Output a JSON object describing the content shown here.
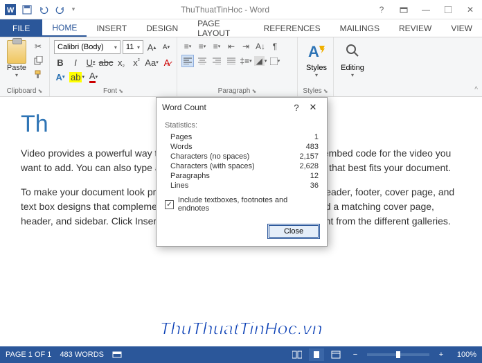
{
  "titlebar": {
    "title": "ThuThuatTinHoc - Word"
  },
  "tabs": {
    "file": "FILE",
    "home": "HOME",
    "insert": "INSERT",
    "design": "DESIGN",
    "page_layout": "PAGE LAYOUT",
    "references": "REFERENCES",
    "mailings": "MAILINGS",
    "review": "REVIEW",
    "view": "VIEW"
  },
  "ribbon": {
    "clipboard": {
      "paste": "Paste",
      "label": "Clipboard"
    },
    "font": {
      "name": "Calibri (Body)",
      "size": "11",
      "label": "Font"
    },
    "paragraph": {
      "label": "Paragraph"
    },
    "styles": {
      "button": "Styles",
      "label": "Styles"
    },
    "editing": {
      "button": "Editing"
    }
  },
  "dialog": {
    "title": "Word Count",
    "help": "?",
    "stats_label": "Statistics:",
    "rows": {
      "pages": {
        "label": "Pages",
        "value": "1"
      },
      "words": {
        "label": "Words",
        "value": "483"
      },
      "chars_ns": {
        "label": "Characters (no spaces)",
        "value": "2,157"
      },
      "chars_ws": {
        "label": "Characters (with spaces)",
        "value": "2,628"
      },
      "paragraphs": {
        "label": "Paragraphs",
        "value": "12"
      },
      "lines": {
        "label": "Lines",
        "value": "36"
      }
    },
    "checkbox": "Include textboxes, footnotes and endnotes",
    "close": "Close"
  },
  "document": {
    "heading": "Th",
    "para1": "Video provides a powerful way to                                                           k Online Video, you can paste in the embed code for the video you want to add. You can also type a keyword to search online for the video that best fits your document.",
    "para2": "To make your document look professionally produced, Word provides header, footer, cover page, and text box designs that complement each other. For example, you can add a matching cover page, header, and sidebar. Click Insert and then choose the elements you want from the different galleries."
  },
  "statusbar": {
    "page": "PAGE 1 OF 1",
    "words": "483 WORDS",
    "zoom": "100%"
  },
  "watermark": "ThuThuatTinHoc.vn"
}
